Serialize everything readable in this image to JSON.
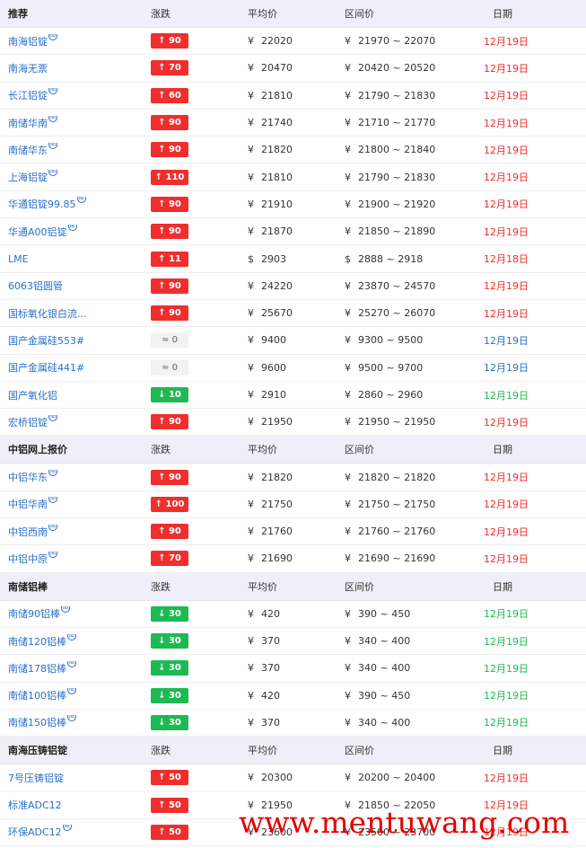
{
  "columns": {
    "change": "涨跌",
    "avg": "平均价",
    "range": "区间价",
    "date": "日期"
  },
  "sections": [
    {
      "title": "推荐",
      "rows": [
        {
          "name": "南海铝锭",
          "sup": true,
          "dir": "up",
          "change": "↑ 90",
          "cur": "¥",
          "avg": "22020",
          "range": "21970 ~ 22070",
          "date": "12月19日"
        },
        {
          "name": "南海无票",
          "sup": false,
          "dir": "up",
          "change": "↑ 70",
          "cur": "¥",
          "avg": "20470",
          "range": "20420 ~ 20520",
          "date": "12月19日"
        },
        {
          "name": "长江铝锭",
          "sup": true,
          "dir": "up",
          "change": "↑ 60",
          "cur": "¥",
          "avg": "21810",
          "range": "21790 ~ 21830",
          "date": "12月19日"
        },
        {
          "name": "南储华南",
          "sup": true,
          "dir": "up",
          "change": "↑ 90",
          "cur": "¥",
          "avg": "21740",
          "range": "21710 ~ 21770",
          "date": "12月19日"
        },
        {
          "name": "南储华东",
          "sup": true,
          "dir": "up",
          "change": "↑ 90",
          "cur": "¥",
          "avg": "21820",
          "range": "21800 ~ 21840",
          "date": "12月19日"
        },
        {
          "name": "上海铝锭",
          "sup": true,
          "dir": "up",
          "change": "↑ 110",
          "cur": "¥",
          "avg": "21810",
          "range": "21790 ~ 21830",
          "date": "12月19日"
        },
        {
          "name": "华通铝锭99.85",
          "sup": true,
          "dir": "up",
          "change": "↑ 90",
          "cur": "¥",
          "avg": "21910",
          "range": "21900 ~ 21920",
          "date": "12月19日"
        },
        {
          "name": "华通A00铝锭",
          "sup": true,
          "dir": "up",
          "change": "↑ 90",
          "cur": "¥",
          "avg": "21870",
          "range": "21850 ~ 21890",
          "date": "12月19日"
        },
        {
          "name": "LME",
          "sup": false,
          "dir": "up",
          "change": "↑ 11",
          "cur": "$",
          "avg": "2903",
          "range": "2888 ~ 2918",
          "date": "12月18日"
        },
        {
          "name": "6063铝圆管",
          "sup": false,
          "dir": "up",
          "change": "↑ 90",
          "cur": "¥",
          "avg": "24220",
          "range": "23870 ~ 24570",
          "date": "12月19日"
        },
        {
          "name": "国标氧化银白流...",
          "sup": false,
          "dir": "up",
          "change": "↑ 90",
          "cur": "¥",
          "avg": "25670",
          "range": "25270 ~ 26070",
          "date": "12月19日"
        },
        {
          "name": "国产金属硅553#",
          "sup": false,
          "dir": "flat",
          "change": "≈ 0",
          "cur": "¥",
          "avg": "9400",
          "range": "9300 ~ 9500",
          "date": "12月19日"
        },
        {
          "name": "国产金属硅441#",
          "sup": false,
          "dir": "flat",
          "change": "≈ 0",
          "cur": "¥",
          "avg": "9600",
          "range": "9500 ~ 9700",
          "date": "12月19日"
        },
        {
          "name": "国产氧化铝",
          "sup": false,
          "dir": "down",
          "change": "↓ 10",
          "cur": "¥",
          "avg": "2910",
          "range": "2860 ~ 2960",
          "date": "12月19日"
        },
        {
          "name": "宏桥铝锭",
          "sup": true,
          "dir": "up",
          "change": "↑ 90",
          "cur": "¥",
          "avg": "21950",
          "range": "21950 ~ 21950",
          "date": "12月19日"
        }
      ]
    },
    {
      "title": "中铝网上报价",
      "rows": [
        {
          "name": "中铝华东",
          "sup": true,
          "dir": "up",
          "change": "↑ 90",
          "cur": "¥",
          "avg": "21820",
          "range": "21820 ~ 21820",
          "date": "12月19日"
        },
        {
          "name": "中铝华南",
          "sup": true,
          "dir": "up",
          "change": "↑ 100",
          "cur": "¥",
          "avg": "21750",
          "range": "21750 ~ 21750",
          "date": "12月19日"
        },
        {
          "name": "中铝西南",
          "sup": true,
          "dir": "up",
          "change": "↑ 90",
          "cur": "¥",
          "avg": "21760",
          "range": "21760 ~ 21760",
          "date": "12月19日"
        },
        {
          "name": "中铝中原",
          "sup": true,
          "dir": "up",
          "change": "↑ 70",
          "cur": "¥",
          "avg": "21690",
          "range": "21690 ~ 21690",
          "date": "12月19日"
        }
      ]
    },
    {
      "title": "南储铝棒",
      "rows": [
        {
          "name": "南储90铝棒",
          "sup": true,
          "dir": "down",
          "change": "↓ 30",
          "cur": "¥",
          "avg": "420",
          "range": "390 ~ 450",
          "date": "12月19日"
        },
        {
          "name": "南储120铝棒",
          "sup": true,
          "dir": "down",
          "change": "↓ 30",
          "cur": "¥",
          "avg": "370",
          "range": "340 ~ 400",
          "date": "12月19日"
        },
        {
          "name": "南储178铝棒",
          "sup": true,
          "dir": "down",
          "change": "↓ 30",
          "cur": "¥",
          "avg": "370",
          "range": "340 ~ 400",
          "date": "12月19日"
        },
        {
          "name": "南储100铝棒",
          "sup": true,
          "dir": "down",
          "change": "↓ 30",
          "cur": "¥",
          "avg": "420",
          "range": "390 ~ 450",
          "date": "12月19日"
        },
        {
          "name": "南储150铝棒",
          "sup": true,
          "dir": "down",
          "change": "↓ 30",
          "cur": "¥",
          "avg": "370",
          "range": "340 ~ 400",
          "date": "12月19日"
        }
      ]
    },
    {
      "title": "南海压铸铝锭",
      "rows": [
        {
          "name": "7号压铸铝锭",
          "sup": false,
          "dir": "up",
          "change": "↑ 50",
          "cur": "¥",
          "avg": "20300",
          "range": "20200 ~ 20400",
          "date": "12月19日"
        },
        {
          "name": "标准ADC12",
          "sup": false,
          "dir": "up",
          "change": "↑ 50",
          "cur": "¥",
          "avg": "21950",
          "range": "21850 ~ 22050",
          "date": "12月19日"
        },
        {
          "name": "环保ADC12",
          "sup": true,
          "dir": "up",
          "change": "↑ 50",
          "cur": "¥",
          "avg": "23600",
          "range": "23500 ~ 23700",
          "date": "12月19日"
        }
      ]
    }
  ],
  "watermark": "www.mentuwang.com"
}
